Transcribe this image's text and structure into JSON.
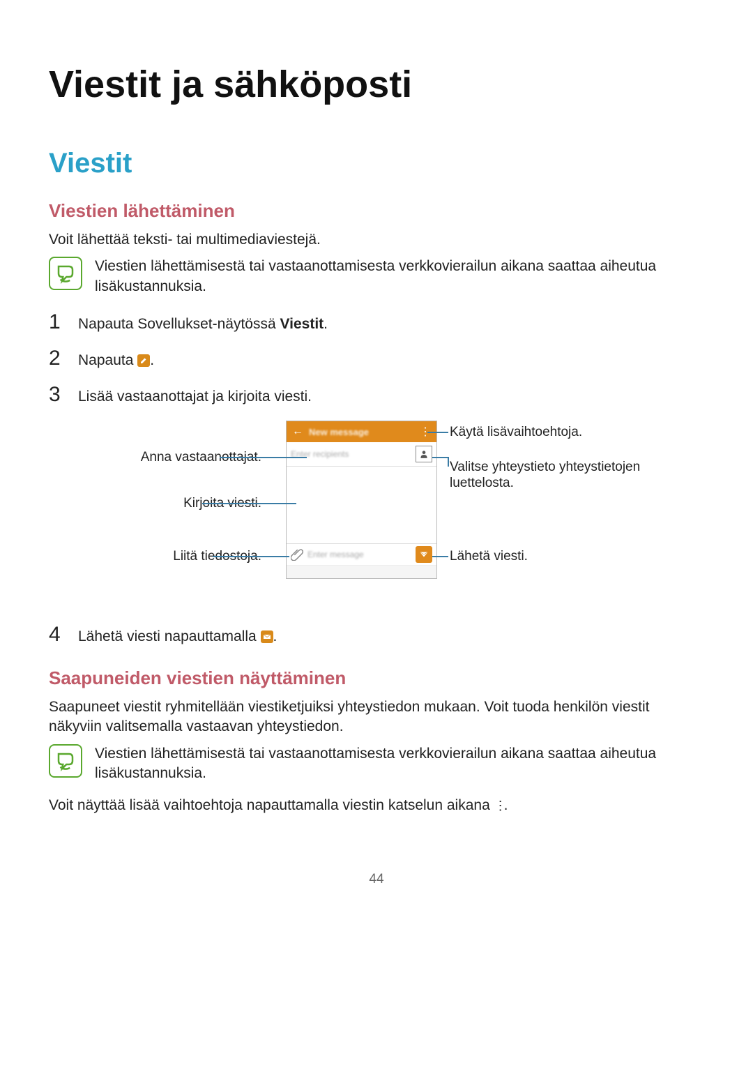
{
  "page": {
    "chapter_title": "Viestit ja sähköposti",
    "section_title": "Viestit",
    "page_number": "44"
  },
  "sending": {
    "subheading": "Viestien lähettäminen",
    "intro": "Voit lähettää teksti- tai multimediaviestejä.",
    "note": "Viestien lähettämisestä tai vastaanottamisesta verkkovierailun aikana saattaa aiheutua lisäkustannuksia.",
    "steps": {
      "s1_pre": "Napauta Sovellukset-näytössä ",
      "s1_bold": "Viestit",
      "s1_post": ".",
      "s2_pre": "Napauta ",
      "s2_post": ".",
      "s3": "Lisää vastaanottajat ja kirjoita viesti.",
      "s4_pre": "Lähetä viesti napauttamalla ",
      "s4_post": "."
    },
    "diagram": {
      "left_recipients": "Anna vastaanottajat.",
      "left_body": "Kirjoita viesti.",
      "left_attach": "Liitä tiedostoja.",
      "right_more": "Käytä lisävaihtoehtoja.",
      "right_contact": "Valitse yhteystieto yhteystietojen luettelosta.",
      "right_send": "Lähetä viesti.",
      "header_title": "New message",
      "recip_placeholder": "Enter recipients",
      "input_placeholder": "Enter message"
    }
  },
  "receiving": {
    "subheading": "Saapuneiden viestien näyttäminen",
    "body": "Saapuneet viestit ryhmitellään viestiketjuiksi yhteystiedon mukaan. Voit tuoda henkilön viestit näkyviin valitsemalla vastaavan yhteystiedon.",
    "note": "Viestien lähettämisestä tai vastaanottamisesta verkkovierailun aikana saattaa aiheutua lisäkustannuksia.",
    "more_pre": "Voit näyttää lisää vaihtoehtoja napauttamalla viestin katselun aikana ",
    "more_post": "."
  }
}
